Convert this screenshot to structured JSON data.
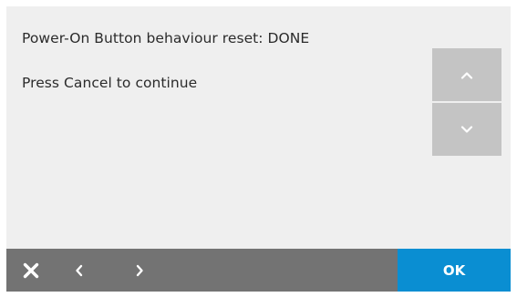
{
  "dialog": {
    "status_message": "Power-On Button behaviour reset: DONE",
    "instruction": "Press Cancel to continue"
  },
  "scroll": {
    "up_icon": "chevron-up-icon",
    "down_icon": "chevron-down-icon"
  },
  "bottom_bar": {
    "close_icon": "close-icon",
    "back_icon": "chevron-left-icon",
    "forward_icon": "chevron-right-icon",
    "ok_label": "OK"
  },
  "colors": {
    "background": "#efefef",
    "scroll_button": "#c4c4c4",
    "bottom_bar": "#737373",
    "accent": "#0a8ed2"
  }
}
